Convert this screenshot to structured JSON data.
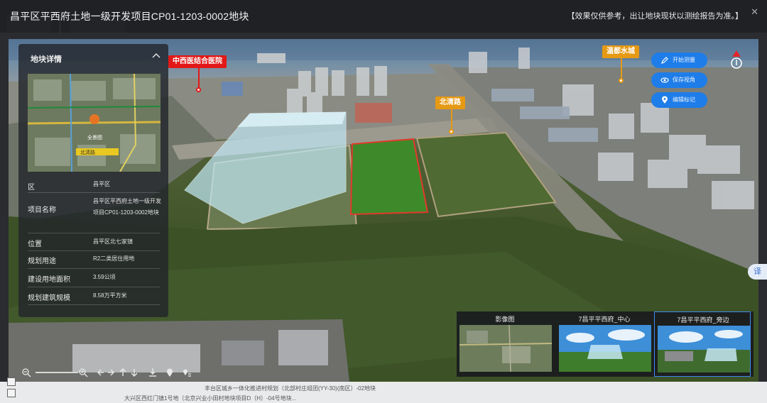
{
  "window": {
    "title": "昌平区平西府土地一级开发项目CP01-1203-0002地块",
    "notice": "【效果仅供参考，出让地块现状以测绘报告为准。】",
    "close_label": "✕"
  },
  "panel": {
    "title": "地块详情",
    "minimap": {
      "center_label": "全景图",
      "road_label": "北清路"
    },
    "rows": [
      {
        "label": "区",
        "value": "昌平区"
      },
      {
        "label": "项目名称",
        "value": "昌平区平西府土地一级开发项目CP01-1203-0002地块"
      },
      {
        "label": "位置",
        "value": "昌平区北七家镇"
      },
      {
        "label": "规划用途",
        "value": "R2二类居住用地"
      },
      {
        "label": "建设用地面积",
        "value": "3.59公顷"
      },
      {
        "label": "规划建筑规模",
        "value": "8.58万平方米"
      }
    ]
  },
  "map_labels": {
    "hospital": "中西医结合医院",
    "road": "北清路",
    "community": "温都水城"
  },
  "actions": {
    "measure": "开始测量",
    "save_view": "保存视角",
    "edit_marker": "编辑标记"
  },
  "translate_label": "译",
  "views": [
    {
      "label": "影像图",
      "selected": false
    },
    {
      "label": "7昌平平西府_中心",
      "selected": false
    },
    {
      "label": "7昌平平西府_旁边",
      "selected": true
    }
  ],
  "colors": {
    "accent": "#1e7de8",
    "poi_red": "#e21818",
    "poi_orange": "#e69913",
    "parcel_green": "#3e8a2a",
    "parcel_border": "#e03a2a",
    "volume": "#bfe6f2"
  },
  "icons": {
    "measure": "pen-icon",
    "save_view": "eye-icon",
    "edit_marker": "pin-icon",
    "compass": "north-arrow-icon",
    "collapse": "chevron-up-icon"
  },
  "footer": {
    "line1": "丰台区城乡一体化推进村规划（北部村庄组团(YY-30)(南区）-02地块",
    "line2": "大兴区西红门镇1号地（北京兴业小田村地块项目D（H）-04号地块..."
  }
}
